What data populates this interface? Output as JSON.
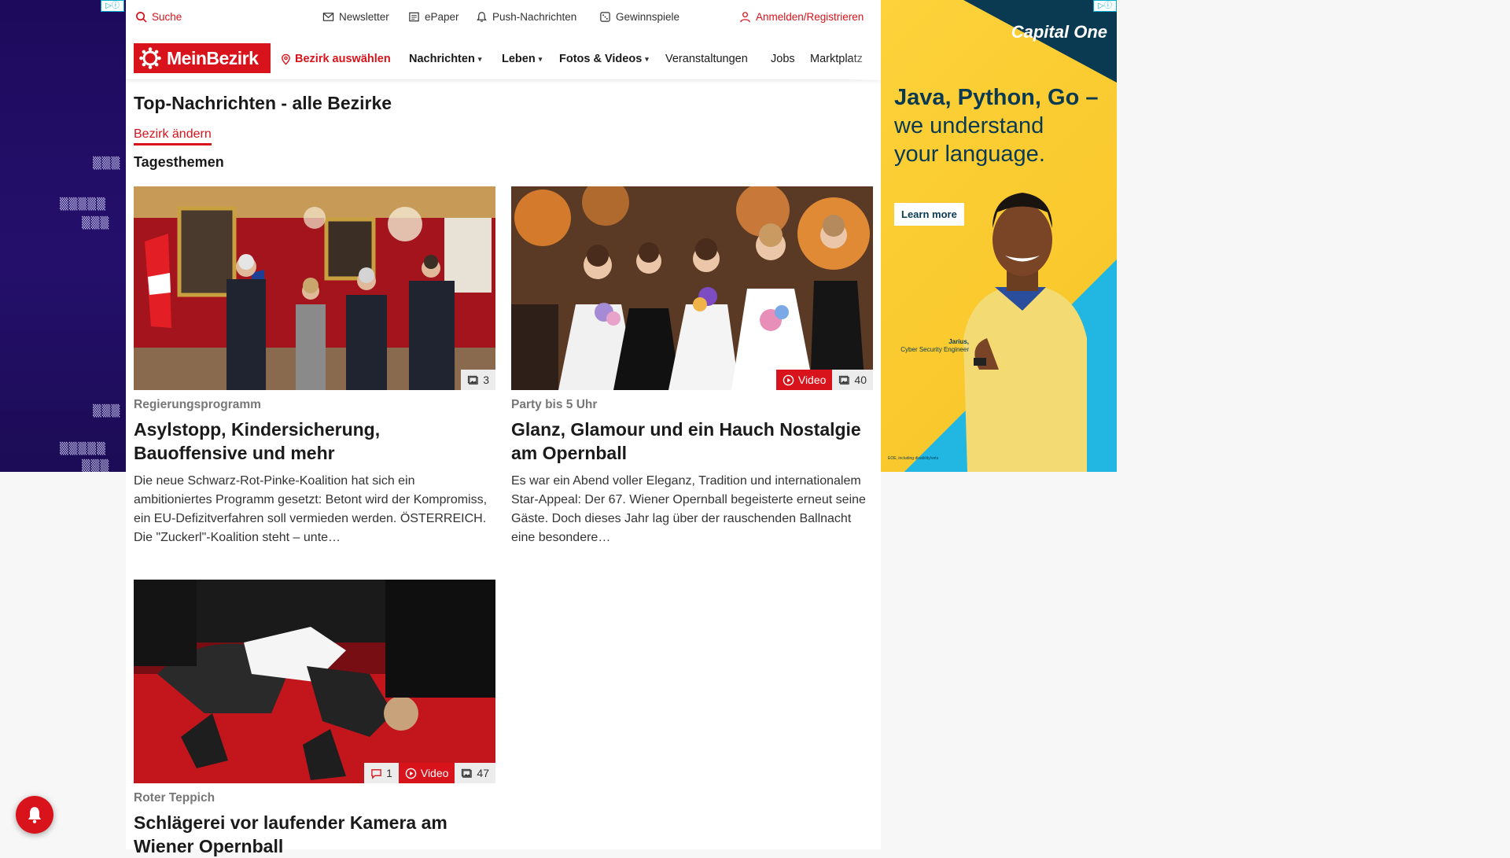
{
  "topbar": {
    "search": "Suche",
    "newsletter": "Newsletter",
    "epaper": "ePaper",
    "push": "Push-Nachrichten",
    "games": "Gewinnspiele",
    "login": "Anmelden/Registrieren"
  },
  "nav": {
    "logo": "MeinBezirk",
    "district": "Bezirk auswählen",
    "items": [
      "Nachrichten",
      "Leben",
      "Fotos & Videos",
      "Veranstaltungen",
      "Jobs",
      "Marktplatz"
    ]
  },
  "page": {
    "title": "Top-Nachrichten - alle Bezirke",
    "change_link": "Bezirk ändern",
    "section": "Tagesthemen"
  },
  "articles": [
    {
      "kicker": "Regierungsprogramm",
      "headline": "Asylstopp, Kindersicherung, Bauoffensive und mehr",
      "teaser": "Die neue Schwarz-Rot-Pinke-Koalition hat sich ein ambitioniertes Programm gesetzt: Betont wird der Kompromiss, ein EU-Defizitverfahren soll vermieden werden.  ÖSTERREICH. Die \"Zuckerl\"-Koalition steht – unte…",
      "photos": "3"
    },
    {
      "kicker": "Party bis 5 Uhr",
      "headline": "Glanz, Glamour und ein Hauch Nostalgie am Opernball",
      "teaser": "Es war ein Abend voller Eleganz, Tradition und internationalem Star-Appeal: Der 67. Wiener Opernball begeisterte erneut seine Gäste. Doch dieses Jahr lag über der rauschenden Ballnacht eine besondere…",
      "video": "Video",
      "photos": "40"
    },
    {
      "kicker": "Roter Teppich",
      "headline": "Schlägerei vor laufender Kamera am Wiener Opernball",
      "comments": "1",
      "video": "Video",
      "photos": "47"
    }
  ],
  "ad": {
    "brand": "Capital One",
    "headline_bold": "Java, Python, Go –",
    "headline_rest": "we understand your language.",
    "cta": "Learn more",
    "caption_name": "Jarius,",
    "caption_role": "Cyber Security Engineer",
    "fine": "EOE, including disability/vets"
  },
  "colors": {
    "brand_red": "#d8131b",
    "ad_navy": "#0a3a52",
    "ad_yellow": "#fdd23a",
    "ad_blue": "#22b7e2"
  }
}
